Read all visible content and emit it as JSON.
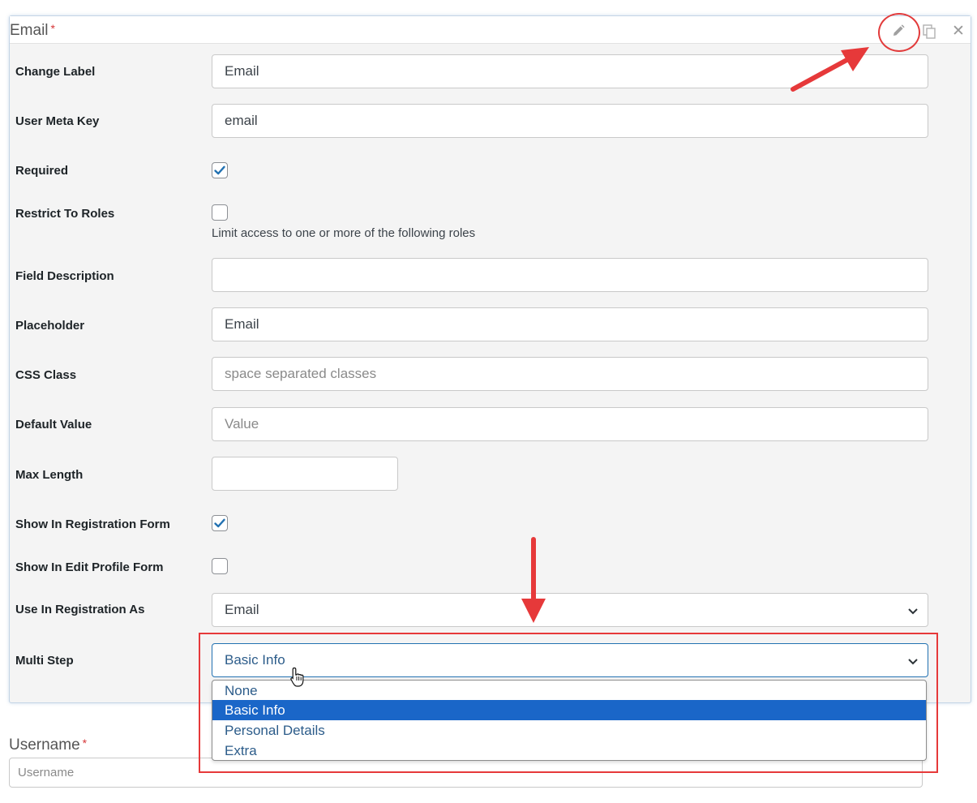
{
  "field": {
    "title": "Email",
    "required_mark": "*",
    "icons": {
      "edit": "pencil-icon",
      "duplicate": "copy-icon",
      "close": "close-icon"
    },
    "close_glyph": "✕"
  },
  "rows": {
    "change_label": {
      "label": "Change Label",
      "value": "Email"
    },
    "user_meta_key": {
      "label": "User Meta Key",
      "value": "email"
    },
    "required": {
      "label": "Required",
      "checked": true
    },
    "restrict_roles": {
      "label": "Restrict To Roles",
      "checked": false,
      "help": "Limit access to one or more of the following roles"
    },
    "field_description": {
      "label": "Field Description",
      "value": ""
    },
    "placeholder": {
      "label": "Placeholder",
      "value": "Email"
    },
    "css_class": {
      "label": "CSS Class",
      "placeholder": "space separated classes"
    },
    "default_value": {
      "label": "Default Value",
      "placeholder": "Value"
    },
    "max_length": {
      "label": "Max Length",
      "value": ""
    },
    "show_registration": {
      "label": "Show In Registration Form",
      "checked": true
    },
    "show_edit_profile": {
      "label": "Show In Edit Profile Form",
      "checked": false
    },
    "use_in_registration": {
      "label": "Use In Registration As",
      "value": "Email"
    },
    "multi_step": {
      "label": "Multi Step",
      "value": "Basic Info",
      "options": [
        "None",
        "Basic Info",
        "Personal Details",
        "Extra"
      ],
      "selected_index": 1
    }
  },
  "username": {
    "label": "Username",
    "required_mark": "*",
    "placeholder": "Username"
  },
  "colors": {
    "annotation": "#e6393a",
    "selected_option": "#1a66c8",
    "checkbox_tick": "#2271b1"
  }
}
